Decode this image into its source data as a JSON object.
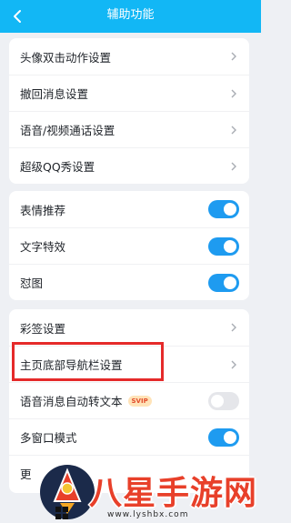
{
  "header": {
    "title": "辅助功能",
    "back_icon": "chevron-left-icon"
  },
  "group1": [
    {
      "label": "头像双击动作设置"
    },
    {
      "label": "撤回消息设置"
    },
    {
      "label": "语音/视频通话设置"
    },
    {
      "label": "超级QQ秀设置"
    }
  ],
  "group2": [
    {
      "label": "表情推荐",
      "enabled": true
    },
    {
      "label": "文字特效",
      "enabled": true
    },
    {
      "label": "怼图",
      "enabled": true
    }
  ],
  "group3": {
    "caiqian": "彩签设置",
    "bottom_nav": "主页底部导航栏设置",
    "voice_to_text": "语音消息自动转文本",
    "voice_to_text_enabled": false,
    "svip_badge": "SVIP",
    "multi_window": "多窗口模式",
    "multi_window_enabled": true,
    "more_partial": "更"
  },
  "watermark": {
    "text": "八星手游网",
    "url": "www.lyshbx.com"
  },
  "colors": {
    "header": "#12b7f5",
    "toggle_on": "#1e9bf0",
    "highlight": "#e52a2a"
  }
}
